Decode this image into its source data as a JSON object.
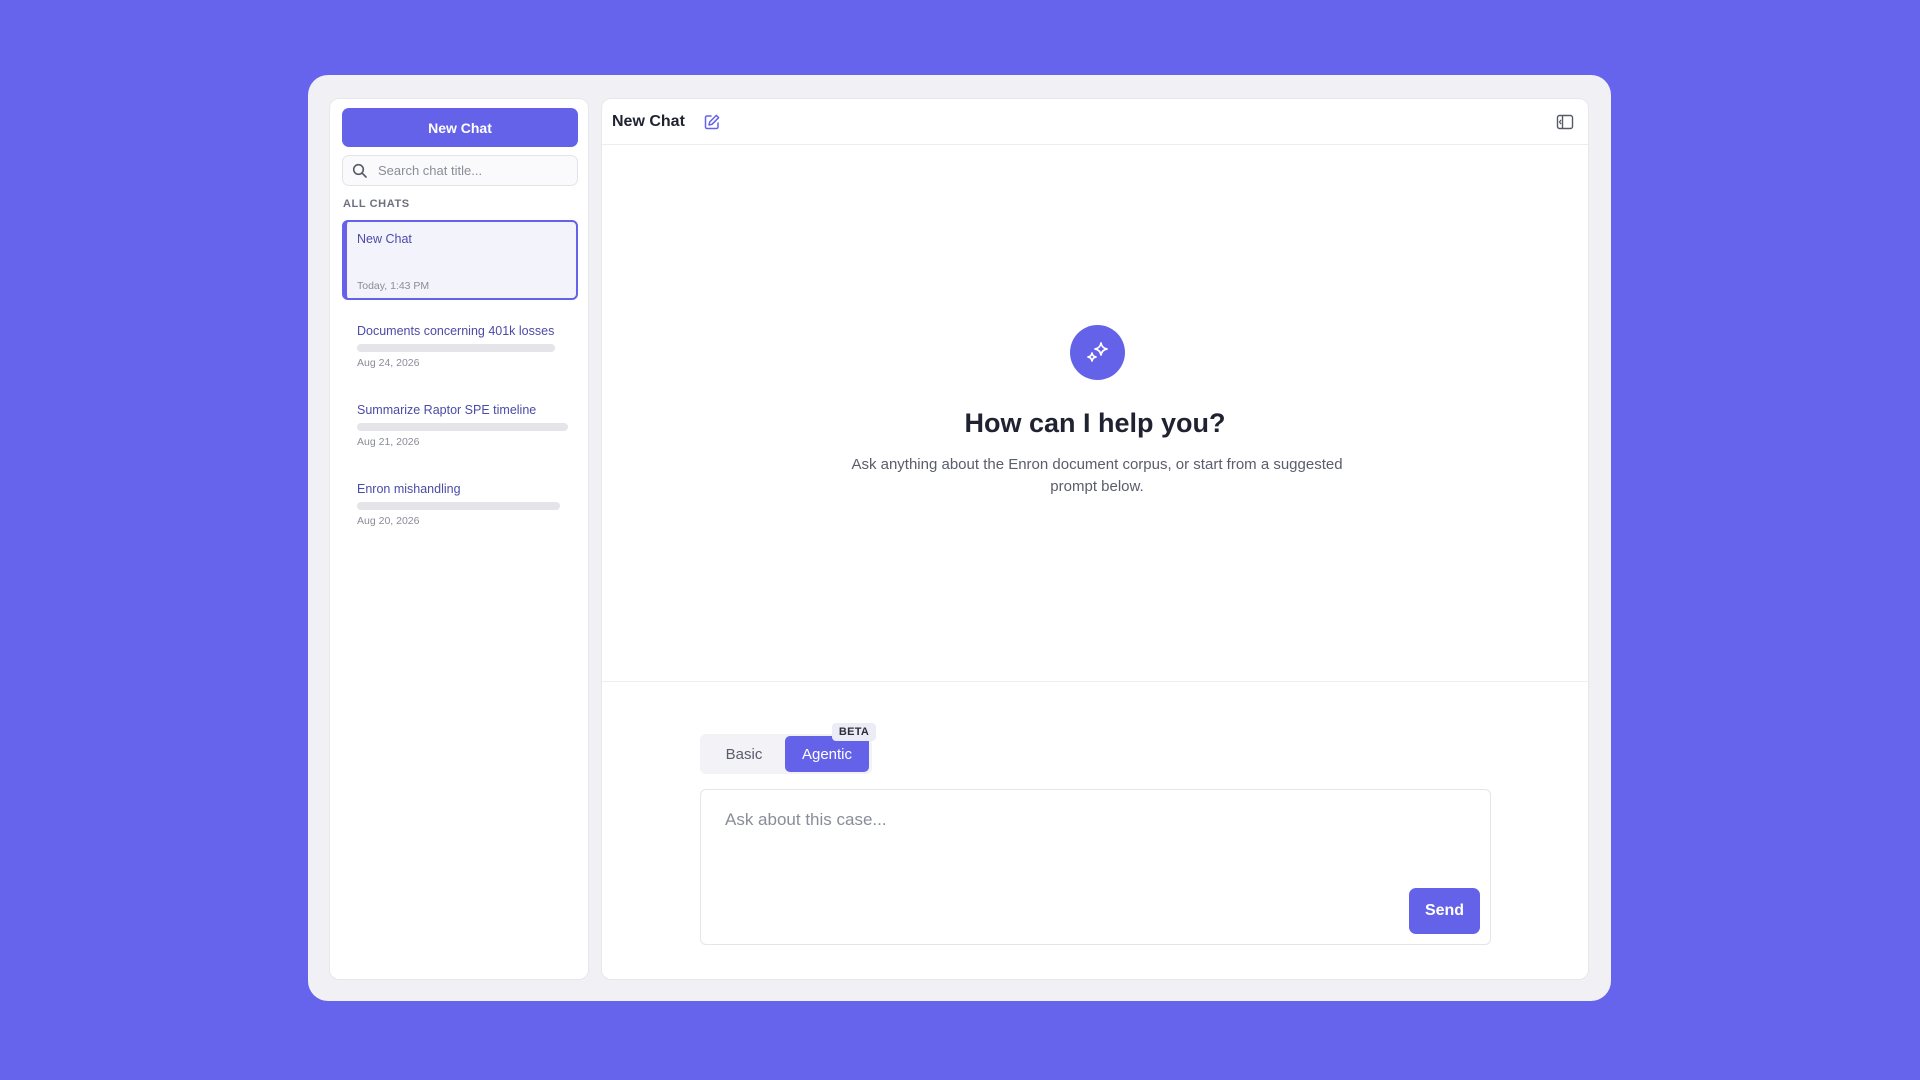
{
  "sidebar": {
    "new_chat_label": "New Chat",
    "search_placeholder": "Search chat title...",
    "section_label": "ALL CHATS",
    "chats": [
      {
        "title": "New Chat",
        "date": "Today, 1:43 PM",
        "active": true
      },
      {
        "title": "Documents concerning 401k losses",
        "date": "Aug 24, 2026"
      },
      {
        "title": "Summarize Raptor SPE timeline",
        "date": "Aug 21, 2026"
      },
      {
        "title": "Enron mishandling",
        "date": "Aug 20, 2026"
      }
    ]
  },
  "header": {
    "title": "New Chat",
    "edit_icon": "edit-icon",
    "panel_icon": "sidebar-toggle-icon"
  },
  "hero": {
    "icon": "sparkles-icon",
    "title": "How can I help you?",
    "subtitle": "Ask anything about the Enron document corpus, or start from a suggested prompt below."
  },
  "mode": {
    "basic_label": "Basic",
    "agentic_label": "Agentic",
    "beta_label": "BETA",
    "selected": "Agentic"
  },
  "composer": {
    "placeholder": "Ask about this case...",
    "send_label": "Send"
  },
  "colors": {
    "background": "#6664ec",
    "accent": "#6462e8",
    "window": "#f1f1f5"
  }
}
